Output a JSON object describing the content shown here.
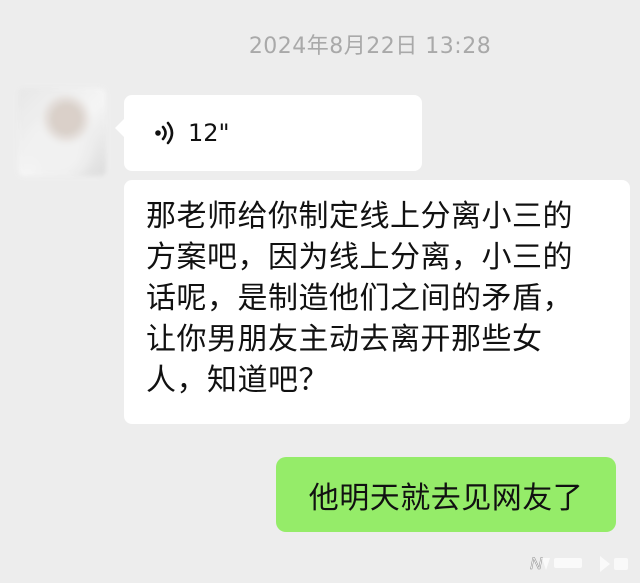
{
  "chat": {
    "timestamp": "2024年8月22日 13:28",
    "voice_message": {
      "duration": "12\"",
      "icon": "voice-wave-icon"
    },
    "incoming_text": {
      "lines": [
        "那老师给你制定线上分离小三的",
        "方案吧，因为线上分离，小三的",
        "话呢，是制造他们之间的矛盾，",
        "让你男朋友主动去离开那些女",
        "人，知道吧？"
      ]
    },
    "outgoing_text": "他明天就去见网友了"
  },
  "colors": {
    "background": "#ededed",
    "incoming_bubble": "#ffffff",
    "outgoing_bubble": "#95ec69",
    "timestamp": "#a9a9a9"
  },
  "watermark": {
    "logo": "news-logo-watermark"
  }
}
